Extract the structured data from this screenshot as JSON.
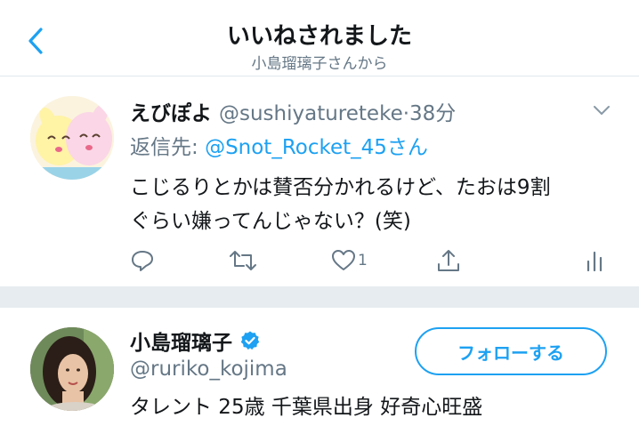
{
  "header": {
    "title": "いいねされました",
    "subtitle": "小島瑠璃子さんから"
  },
  "tweet": {
    "display_name": "えびぽよ",
    "handle_time": "@sushiyatureteke·38分",
    "reply_prefix": "返信先: ",
    "reply_mention": "@Snot_Rocket_45さん",
    "text_line1": "こじるりとかは賛否分かれるけど、たおは9割",
    "text_line2": "ぐらい嫌ってんじゃない？(笑)",
    "like_count": "1"
  },
  "user": {
    "name": "小島瑠璃子",
    "handle": "@ruriko_kojima",
    "bio": "タレント 25歳 千葉県出身 好奇心旺盛",
    "follow_label": "フォローする"
  },
  "colors": {
    "accent": "#1da1f2",
    "secondary_text": "#657786",
    "separator": "#e6ecf0"
  },
  "icons": [
    "back-chevron-icon",
    "caret-down-icon",
    "reply-icon",
    "retweet-icon",
    "heart-icon",
    "share-icon",
    "analytics-icon",
    "verified-badge-icon"
  ]
}
